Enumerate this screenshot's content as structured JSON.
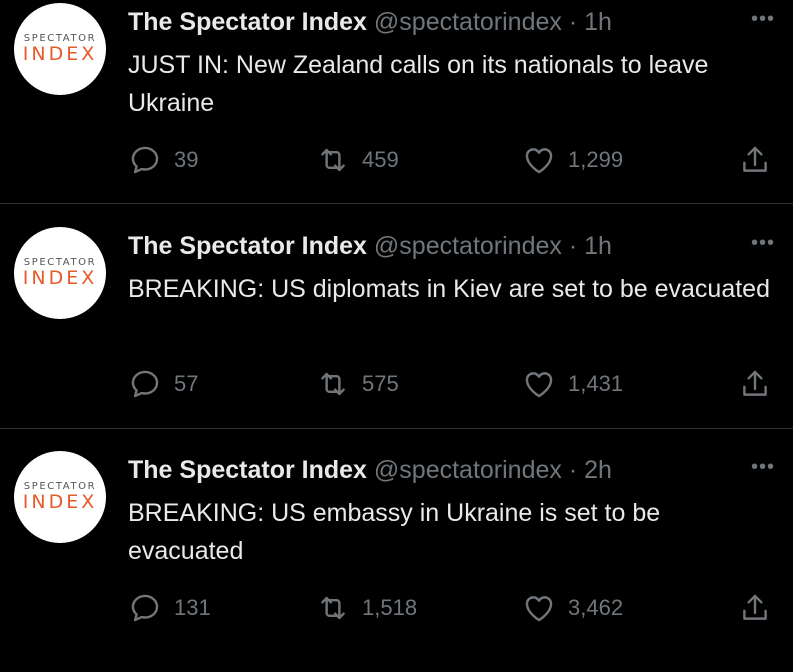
{
  "tweets": [
    {
      "name": "The Spectator Index",
      "handle": "@spectatorindex",
      "time": "1h",
      "text": "JUST IN: New Zealand calls on its nationals to leave Ukraine",
      "replies": "39",
      "retweets": "459",
      "likes": "1,299",
      "avatar_top": "SPECTATOR",
      "avatar_bottom": "INDEX"
    },
    {
      "name": "The Spectator Index",
      "handle": "@spectatorindex",
      "time": "1h",
      "text": "BREAKING: US diplomats in Kiev are set to be evacuated",
      "replies": "57",
      "retweets": "575",
      "likes": "1,431",
      "avatar_top": "SPECTATOR",
      "avatar_bottom": "INDEX"
    },
    {
      "name": "The Spectator Index",
      "handle": "@spectatorindex",
      "time": "2h",
      "text": "BREAKING: US embassy in Ukraine is set to be evacuated",
      "replies": "131",
      "retweets": "1,518",
      "likes": "3,462",
      "avatar_top": "SPECTATOR",
      "avatar_bottom": "INDEX"
    }
  ],
  "separator": "·",
  "more_glyph": "•••",
  "icons": [
    "reply-icon",
    "retweet-icon",
    "like-icon",
    "share-icon",
    "more-icon"
  ],
  "colors": {
    "background": "#000000",
    "text": "#e7e9ea",
    "muted": "#71767b",
    "brand_orange": "#e85a2a"
  }
}
